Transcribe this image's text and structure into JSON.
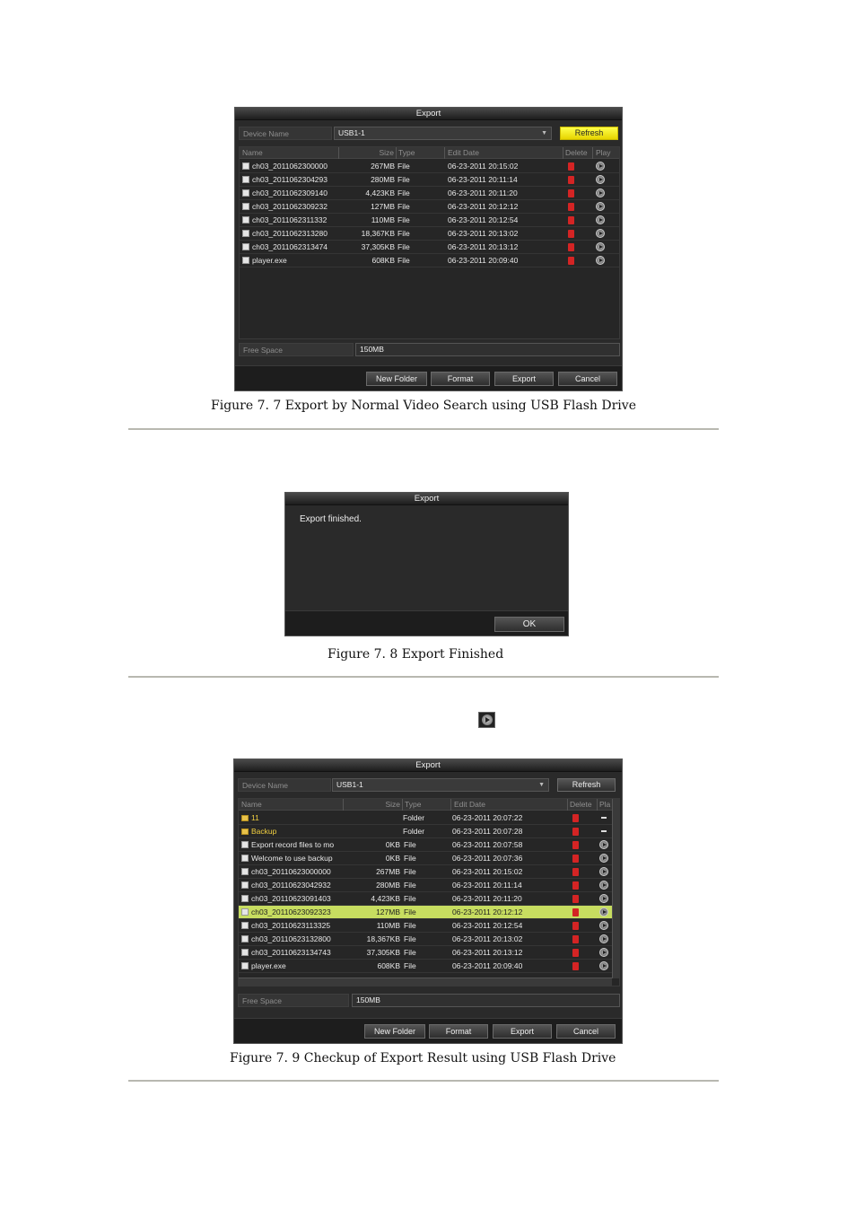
{
  "figure1": {
    "title": "Export",
    "device_label": "Device Name",
    "device_value": "USB1-1",
    "refresh_label": "Refresh",
    "headers": {
      "name": "Name",
      "size": "Size",
      "type": "Type",
      "date": "Edit Date",
      "delete": "Delete",
      "play": "Play"
    },
    "rows": [
      {
        "name": "ch03_2011062300000",
        "size": "267MB",
        "type": "File",
        "date": "06-23-2011 20:15:02"
      },
      {
        "name": "ch03_2011062304293",
        "size": "280MB",
        "type": "File",
        "date": "06-23-2011 20:11:14"
      },
      {
        "name": "ch03_2011062309140",
        "size": "4,423KB",
        "type": "File",
        "date": "06-23-2011 20:11:20"
      },
      {
        "name": "ch03_2011062309232",
        "size": "127MB",
        "type": "File",
        "date": "06-23-2011 20:12:12"
      },
      {
        "name": "ch03_2011062311332",
        "size": "110MB",
        "type": "File",
        "date": "06-23-2011 20:12:54"
      },
      {
        "name": "ch03_2011062313280",
        "size": "18,367KB",
        "type": "File",
        "date": "06-23-2011 20:13:02"
      },
      {
        "name": "ch03_2011062313474",
        "size": "37,305KB",
        "type": "File",
        "date": "06-23-2011 20:13:12"
      },
      {
        "name": "player.exe",
        "size": "608KB",
        "type": "File",
        "date": "06-23-2011 20:09:40"
      }
    ],
    "free_label": "Free Space",
    "free_value": "150MB",
    "buttons": {
      "new_folder": "New Folder",
      "format": "Format",
      "export": "Export",
      "cancel": "Cancel"
    },
    "caption": "Figure 7. 7  Export by Normal Video Search using USB Flash Drive"
  },
  "figure2": {
    "title": "Export",
    "message": "Export finished.",
    "ok_label": "OK",
    "caption": "Figure 7. 8 Export Finished"
  },
  "figure3": {
    "title": "Export",
    "device_label": "Device Name",
    "device_value": "USB1-1",
    "refresh_label": "Refresh",
    "headers": {
      "name": "Name",
      "size": "Size",
      "type": "Type",
      "date": "Edit Date",
      "delete": "Delete",
      "play": "Pla"
    },
    "rows": [
      {
        "name": "11",
        "size": "",
        "type": "Folder",
        "date": "06-23-2011 20:07:22",
        "kind": "folder"
      },
      {
        "name": "Backup",
        "size": "",
        "type": "Folder",
        "date": "06-23-2011 20:07:28",
        "kind": "folder"
      },
      {
        "name": "Export record files to mo",
        "size": "0KB",
        "type": "File",
        "date": "06-23-2011 20:07:58",
        "kind": "file"
      },
      {
        "name": "Welcome to use backup",
        "size": "0KB",
        "type": "File",
        "date": "06-23-2011 20:07:36",
        "kind": "file"
      },
      {
        "name": "ch03_20110623000000",
        "size": "267MB",
        "type": "File",
        "date": "06-23-2011 20:15:02",
        "kind": "file"
      },
      {
        "name": "ch03_20110623042932",
        "size": "280MB",
        "type": "File",
        "date": "06-23-2011 20:11:14",
        "kind": "file"
      },
      {
        "name": "ch03_20110623091403",
        "size": "4,423KB",
        "type": "File",
        "date": "06-23-2011 20:11:20",
        "kind": "file"
      },
      {
        "name": "ch03_20110623092323",
        "size": "127MB",
        "type": "File",
        "date": "06-23-2011 20:12:12",
        "kind": "file",
        "selected": true
      },
      {
        "name": "ch03_20110623113325",
        "size": "110MB",
        "type": "File",
        "date": "06-23-2011 20:12:54",
        "kind": "file"
      },
      {
        "name": "ch03_20110623132800",
        "size": "18,367KB",
        "type": "File",
        "date": "06-23-2011 20:13:02",
        "kind": "file"
      },
      {
        "name": "ch03_20110623134743",
        "size": "37,305KB",
        "type": "File",
        "date": "06-23-2011 20:13:12",
        "kind": "file"
      },
      {
        "name": "player.exe",
        "size": "608KB",
        "type": "File",
        "date": "06-23-2011 20:09:40",
        "kind": "file"
      }
    ],
    "free_label": "Free Space",
    "free_value": "150MB",
    "buttons": {
      "new_folder": "New Folder",
      "format": "Format",
      "export": "Export",
      "cancel": "Cancel"
    },
    "caption": "Figure 7. 9  Checkup of Export Result using USB Flash Drive"
  },
  "colors": {
    "refresh_yellow": "#f2e400",
    "selected_row": "#c7dd60",
    "delete_red": "#d42424"
  }
}
